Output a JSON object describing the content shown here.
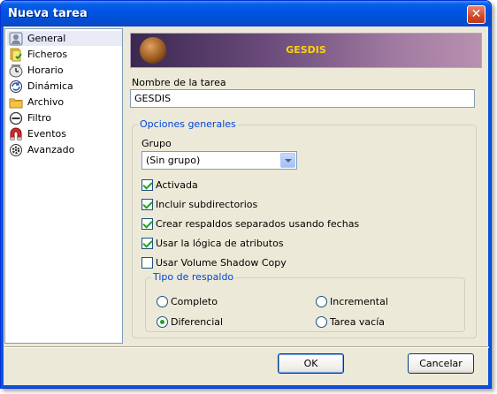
{
  "window": {
    "title": "Nueva tarea",
    "close_label": "✕"
  },
  "sidebar": {
    "items": [
      {
        "label": "General",
        "icon": "general-icon",
        "selected": true
      },
      {
        "label": "Ficheros",
        "icon": "files-icon"
      },
      {
        "label": "Horario",
        "icon": "clock-icon"
      },
      {
        "label": "Dinámica",
        "icon": "dynamic-icon"
      },
      {
        "label": "Archivo",
        "icon": "folder-icon"
      },
      {
        "label": "Filtro",
        "icon": "filter-icon"
      },
      {
        "label": "Eventos",
        "icon": "magnet-icon"
      },
      {
        "label": "Avanzado",
        "icon": "gear-icon"
      }
    ]
  },
  "banner": {
    "title": "GESDIS"
  },
  "form": {
    "task_name_label": "Nombre de la tarea",
    "task_name_value": "GESDIS",
    "general_options_legend": "Opciones generales",
    "group_label": "Grupo",
    "group_value": "(Sin grupo)",
    "checkboxes": [
      {
        "label": "Activada",
        "checked": true
      },
      {
        "label": "Incluir subdirectorios",
        "checked": true
      },
      {
        "label": "Crear respaldos separados usando fechas",
        "checked": true
      },
      {
        "label": "Usar la lógica de atributos",
        "checked": true
      },
      {
        "label": "Usar Volume Shadow Copy",
        "checked": false
      }
    ],
    "backup_type_legend": "Tipo de respaldo",
    "radios": [
      {
        "label": "Completo",
        "checked": false
      },
      {
        "label": "Incremental",
        "checked": false
      },
      {
        "label": "Diferencial",
        "checked": true
      },
      {
        "label": "Tarea vacía",
        "checked": false
      }
    ]
  },
  "buttons": {
    "ok": "OK",
    "cancel": "Cancelar"
  },
  "colors": {
    "titlebar": "#0054e3",
    "window_bg": "#ece9d8",
    "legend": "#0046d5",
    "banner_text": "#ffd400",
    "check": "#21a121"
  }
}
